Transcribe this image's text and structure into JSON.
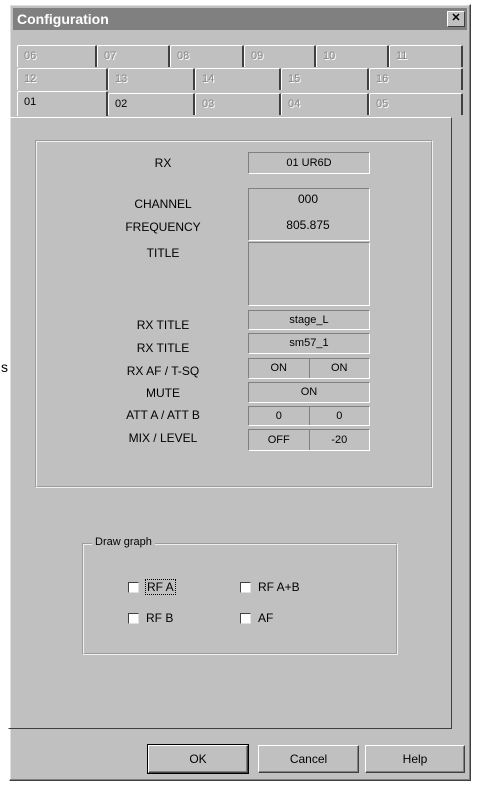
{
  "window": {
    "title": "Configuration",
    "close_glyph": "✕"
  },
  "tabs": {
    "row1": [
      "06",
      "07",
      "08",
      "09",
      "10",
      "11"
    ],
    "row2": [
      "12",
      "13",
      "14",
      "15",
      "16"
    ],
    "row3": [
      "01",
      "02",
      "03",
      "04",
      "05"
    ],
    "active": "01"
  },
  "rx_info": {
    "rx_label": "RX",
    "rx_value": "01 UR6D",
    "channel_label": "CHANNEL",
    "channel_value": "000",
    "frequency_label": "FREQUENCY",
    "frequency_value": "805.875",
    "title_label": "TITLE",
    "title_value": "",
    "rx_title_label": "RX TITLE",
    "rx_title_value": "stage_L",
    "rx_title2_label": "RX TITLE",
    "rx_title2_value": "sm57_1",
    "rxaf_label": "RX AF / T-SQ",
    "rxaf_value": "ON",
    "tsq_value": "ON",
    "mute_label": "MUTE",
    "mute_value": "ON",
    "att_label": "ATT A / ATT B",
    "att_a_value": "0",
    "att_b_value": "0",
    "mix_label": "MIX / LEVEL",
    "mix_value": "OFF",
    "level_value": "-20"
  },
  "draw_graph": {
    "legend": "Draw graph",
    "rf_a": "RF A",
    "rf_ab": "RF A+B",
    "rf_b": "RF B",
    "af": "AF"
  },
  "buttons": {
    "ok": "OK",
    "cancel": "Cancel",
    "help": "Help"
  },
  "side_text": "s"
}
